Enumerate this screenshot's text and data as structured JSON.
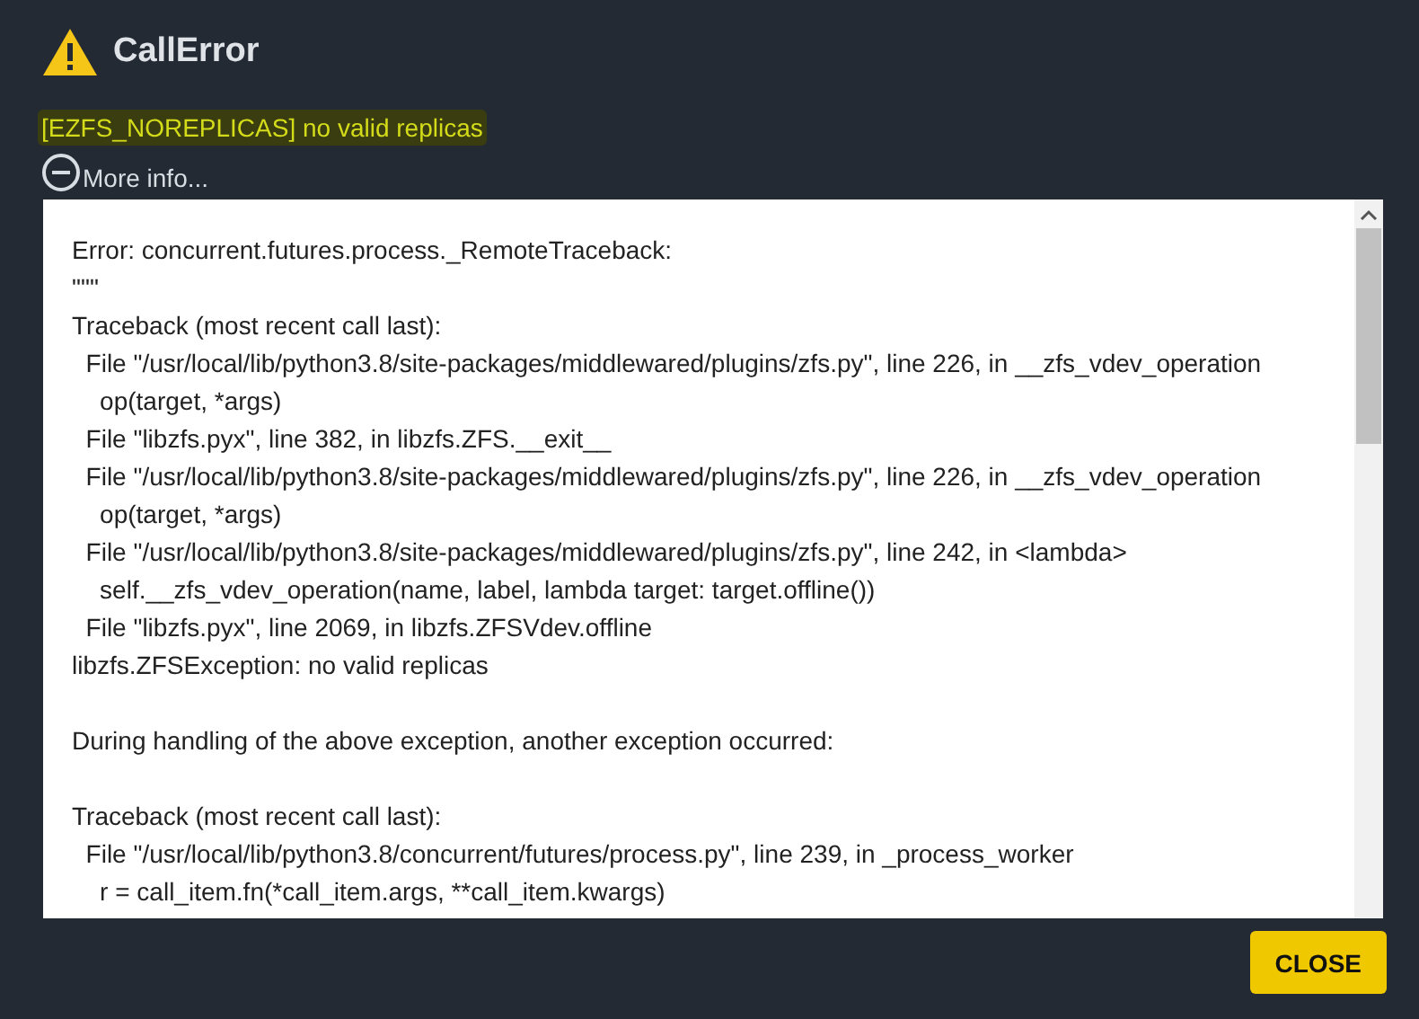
{
  "dialog": {
    "title": "CallError",
    "message": "[EZFS_NOREPLICAS] no valid replicas",
    "more_info": {
      "label": "More info...",
      "expanded": true
    },
    "traceback": [
      [
        "Error: concurrent.futures.process._RemoteTraceback:",
        "\"\"\"",
        "Traceback (most recent call last):",
        "  File \"/usr/local/lib/python3.8/site-packages/middlewared/plugins/zfs.py\", line 226, in __zfs_vdev_operation",
        "    op(target, *args)",
        "  File \"libzfs.pyx\", line 382, in libzfs.ZFS.__exit__",
        "  File \"/usr/local/lib/python3.8/site-packages/middlewared/plugins/zfs.py\", line 226, in __zfs_vdev_operation",
        "    op(target, *args)",
        "  File \"/usr/local/lib/python3.8/site-packages/middlewared/plugins/zfs.py\", line 242, in <lambda>",
        "    self.__zfs_vdev_operation(name, label, lambda target: target.offline())",
        "  File \"libzfs.pyx\", line 2069, in libzfs.ZFSVdev.offline",
        "libzfs.ZFSException: no valid replicas"
      ],
      [
        "During handling of the above exception, another exception occurred:"
      ],
      [
        "Traceback (most recent call last):",
        "  File \"/usr/local/lib/python3.8/concurrent/futures/process.py\", line 239, in _process_worker",
        "    r = call_item.fn(*call_item.args, **call_item.kwargs)"
      ]
    ],
    "buttons": [
      "CLOSE"
    ]
  }
}
